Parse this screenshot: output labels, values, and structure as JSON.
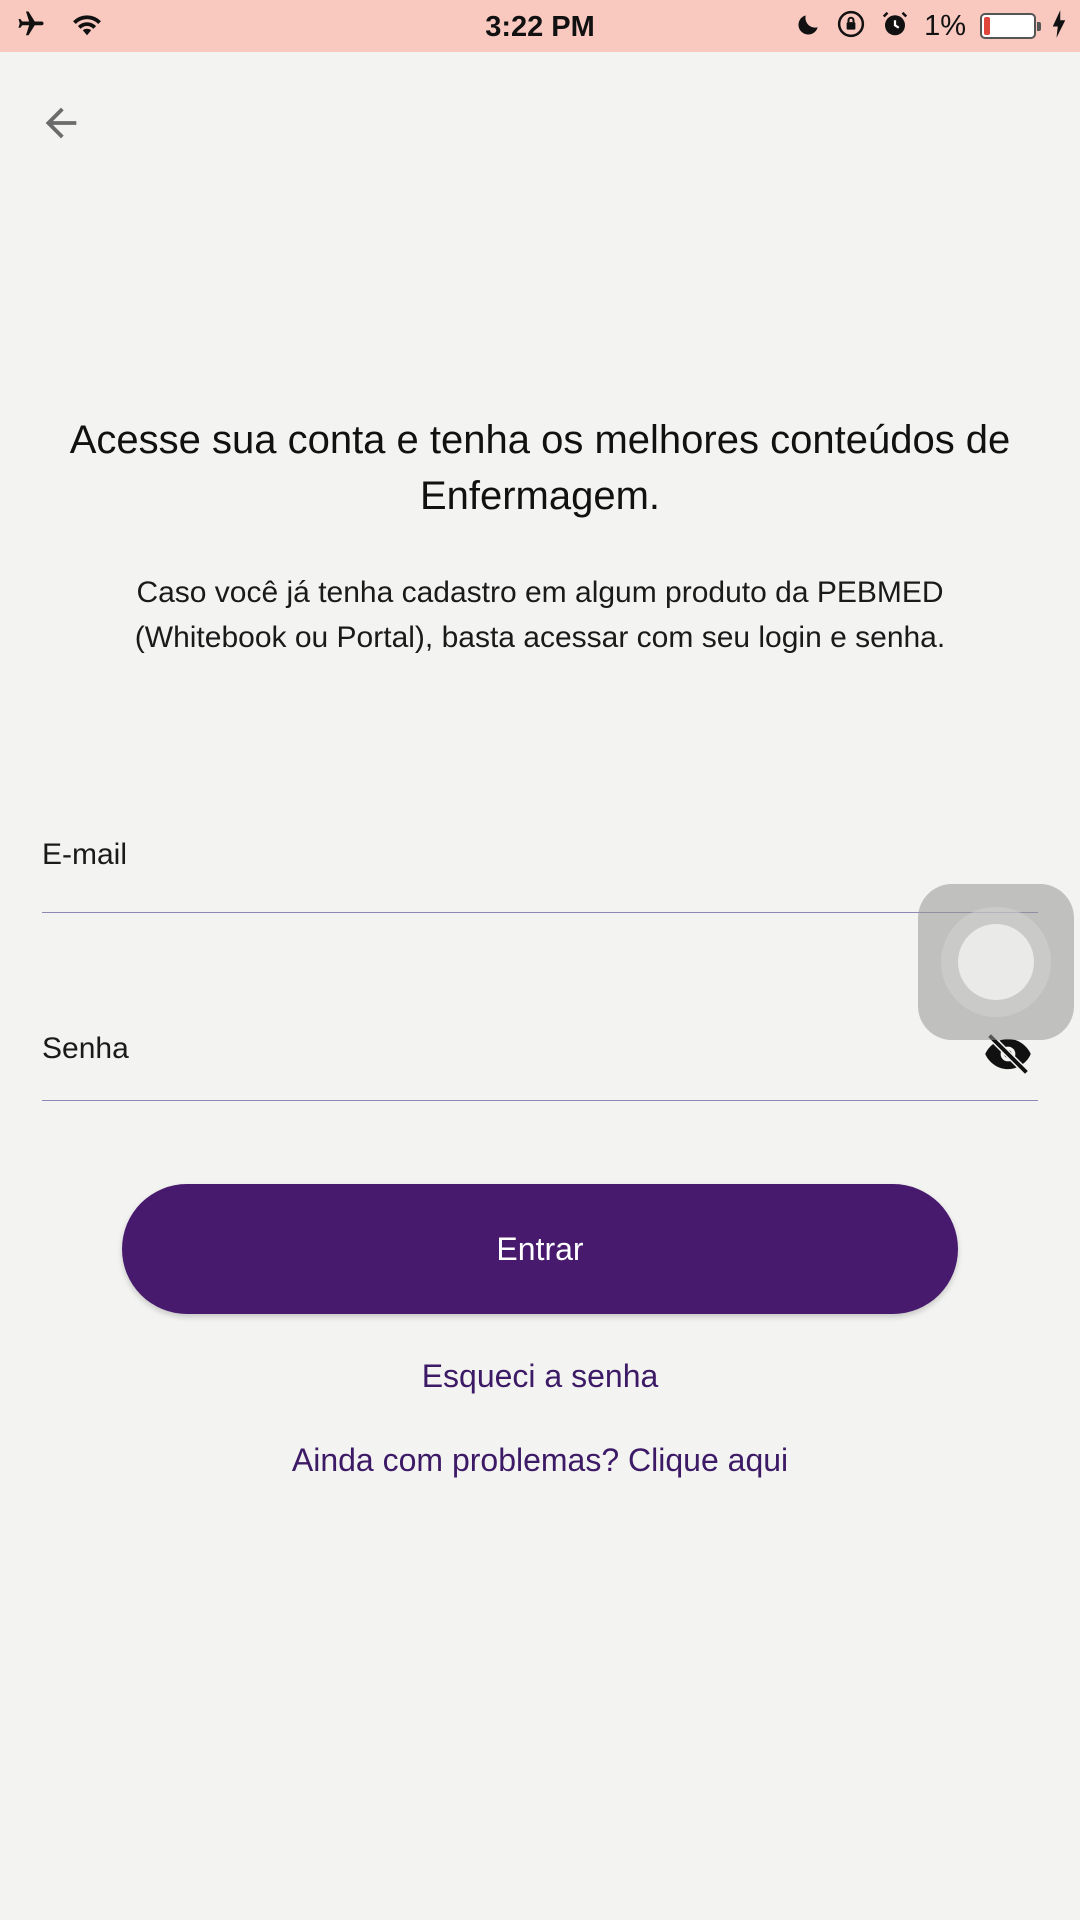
{
  "status_bar": {
    "time": "3:22 PM",
    "battery_text": "1%",
    "icons": [
      "airplane-icon",
      "wifi-icon",
      "moon-icon",
      "rotation-lock-icon",
      "alarm-icon",
      "battery-icon",
      "charging-icon"
    ],
    "background_color": "#f9c9c0"
  },
  "header": {
    "back_icon": "arrow-left-icon"
  },
  "intro": {
    "headline": "Acesse sua conta e tenha os melhores conteúdos de Enfermagem.",
    "subtext": "Caso você já tenha cadastro em algum produto da PEBMED (Whitebook ou Portal), basta acessar com seu login e senha."
  },
  "form": {
    "email_label": "E-mail",
    "password_label": "Senha",
    "password_toggle_icon": "eye-off-icon",
    "submit_label": "Entrar",
    "forgot_link": "Esqueci a senha",
    "help_link": "Ainda com problemas? Clique aqui"
  },
  "colors": {
    "primary": "#471a6d",
    "link": "#3d1a66",
    "background": "#f3f3f1"
  }
}
